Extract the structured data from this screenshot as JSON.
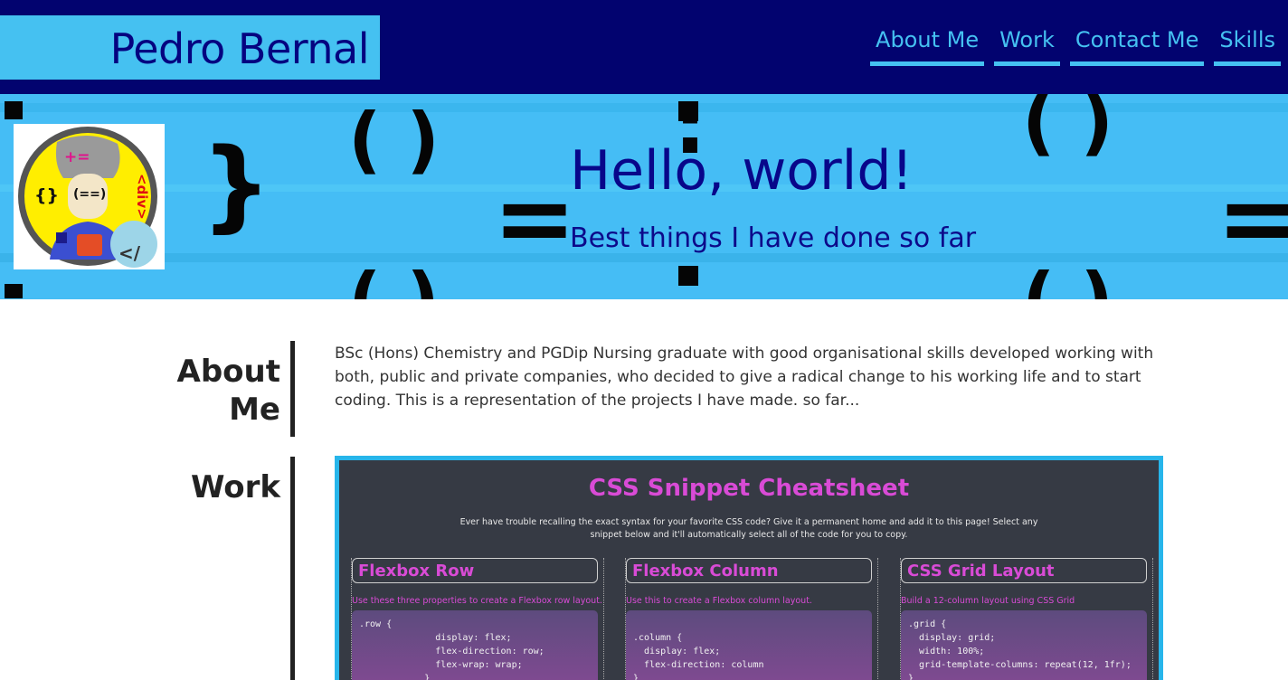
{
  "header": {
    "brand": "Pedro Bernal",
    "nav": [
      "About Me",
      "Work",
      "Contact Me",
      "Skills"
    ]
  },
  "hero": {
    "title": "Hello, world!",
    "subtitle": "Best things I have done so far",
    "background_glyphs": [
      "{",
      "}",
      "( )",
      "=",
      ":",
      "( )",
      "=",
      ":",
      "!="
    ],
    "avatar_glyphs": [
      "+=",
      "{}",
      "(==)",
      "<div>",
      "</"
    ]
  },
  "about": {
    "label": "About Me",
    "text": "BSc (Hons) Chemistry and PGDip Nursing graduate with good organisational skills developed working with both, public and private companies, who decided to give a radical change to his working life and to start coding. This is a representation of the projects I have made. so far..."
  },
  "work": {
    "label": "Work",
    "card": {
      "title": "CSS Snippet Cheatsheet",
      "description": "Ever have trouble recalling the exact syntax for your favorite CSS code? Give it a permanent home and add it to this page! Select any snippet below and it'll automatically select all of the code for you to copy.",
      "columns": [
        {
          "title": "Flexbox Row",
          "desc": "Use these three properties to create a Flexbox row layout.",
          "code": ".row {\n              display: flex;\n              flex-direction: row;\n              flex-wrap: wrap;\n            }"
        },
        {
          "title": "Flexbox Column",
          "desc": "Use this to create a Flexbox column layout.",
          "code": "\n.column {\n  display: flex;\n  flex-direction: column\n}"
        },
        {
          "title": "CSS Grid Layout",
          "desc": "Build a 12-column layout using CSS Grid",
          "code": ".grid {\n  display: grid;\n  width: 100%;\n  grid-template-columns: repeat(12, 1fr);\n}"
        }
      ]
    }
  },
  "colors": {
    "header_bg": "#02036f",
    "accent": "#45c1f1",
    "hero_bg": "#45bdf5",
    "title_blue": "#08068a",
    "snippet_pink": "#d94bd6",
    "card_bg": "#363a44"
  }
}
